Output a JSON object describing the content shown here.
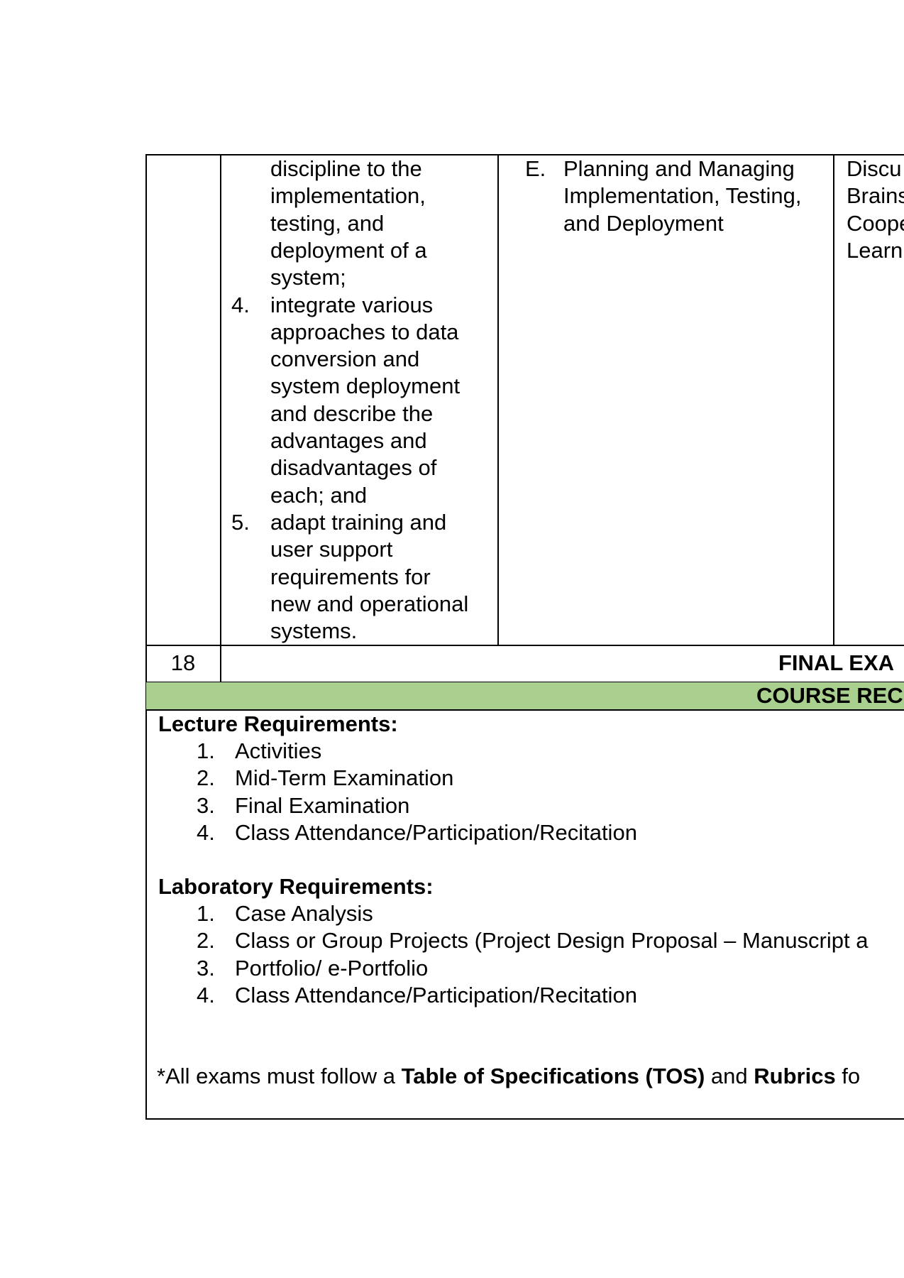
{
  "row1": {
    "objectives": [
      {
        "number": "",
        "lines": [
          "discipline to the",
          "implementation,",
          "testing, and",
          "deployment of a",
          "system;"
        ]
      },
      {
        "number": "4.",
        "lines": [
          "integrate various",
          "approaches to data",
          "conversion and",
          "system deployment",
          "and describe the",
          "advantages and",
          "disadvantages of",
          "each; and"
        ]
      },
      {
        "number": "5.",
        "lines": [
          "adapt training and",
          "user support",
          "requirements for",
          "new and operational",
          "systems."
        ]
      }
    ],
    "topic": {
      "letter": "E.",
      "lines": [
        "Planning and Managing",
        "Implementation, Testing,",
        "and Deployment"
      ]
    },
    "methods": [
      "Discu",
      "Brains",
      "Coope",
      "Learn"
    ]
  },
  "row2": {
    "week": "18",
    "label": "FINAL EXA"
  },
  "section_header": "COURSE REC",
  "requirements": {
    "lecture_title": "Lecture Requirements:",
    "lecture_items": [
      "Activities",
      "Mid-Term Examination",
      "Final Examination",
      "Class Attendance/Participation/Recitation"
    ],
    "lab_title": "Laboratory Requirements:",
    "lab_items": [
      "Case Analysis",
      "Class or Group Projects (Project Design Proposal – Manuscript a",
      "Portfolio/ e-Portfolio",
      "Class Attendance/Participation/Recitation"
    ],
    "note": {
      "pre": "*All exams must follow a ",
      "bold1": "Table of Specifications (TOS)",
      "mid": " and ",
      "bold2": "Rubrics",
      "post": " fo"
    }
  }
}
